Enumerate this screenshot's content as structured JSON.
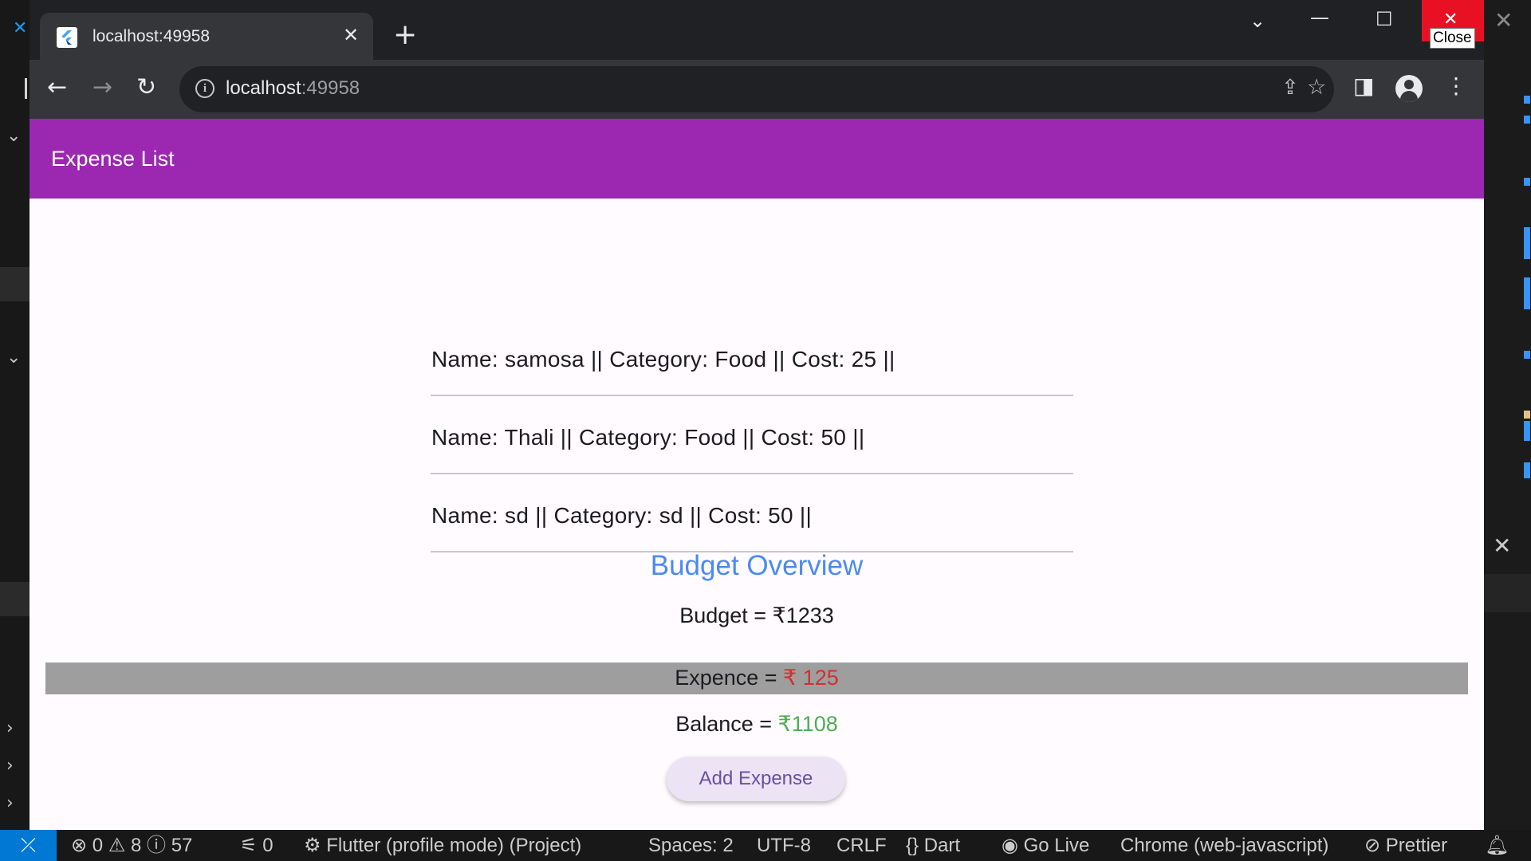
{
  "browser": {
    "tab_title": "localhost:49958",
    "tab_close": "✕",
    "new_tab": "+",
    "url_host": "localhost",
    "url_port": ":49958",
    "close_tooltip": "Close"
  },
  "app": {
    "title": "Expense List",
    "expenses": [
      "Name: samosa || Category: Food || Cost: 25 ||",
      "Name: Thali || Category: Food || Cost: 50 ||",
      "Name: sd || Category: sd || Cost: 50 ||"
    ],
    "budget_title": "Budget Overview",
    "budget_text": "Budget = ₹1233",
    "expence_label": "Expence = ",
    "expence_value": "₹ 125",
    "balance_label": "Balance = ",
    "balance_value": "₹1108",
    "add_button": "Add Expense"
  },
  "statusbar": {
    "errors": "0",
    "warnings": "8",
    "infos": "57",
    "ports": "0",
    "flutter": "Flutter (profile mode) (Project)",
    "spaces": "Spaces: 2",
    "encoding": "UTF-8",
    "eol": "CRLF",
    "language": "Dart",
    "go_live": "Go Live",
    "device": "Chrome (web-javascript)",
    "prettier": "Prettier"
  },
  "colors": {
    "appbar": "#9c27b0",
    "accent_blue": "#4a8af4",
    "expence_red": "#d32f2f",
    "balance_green": "#4caf50",
    "statusbar_remote": "#0078d4"
  }
}
